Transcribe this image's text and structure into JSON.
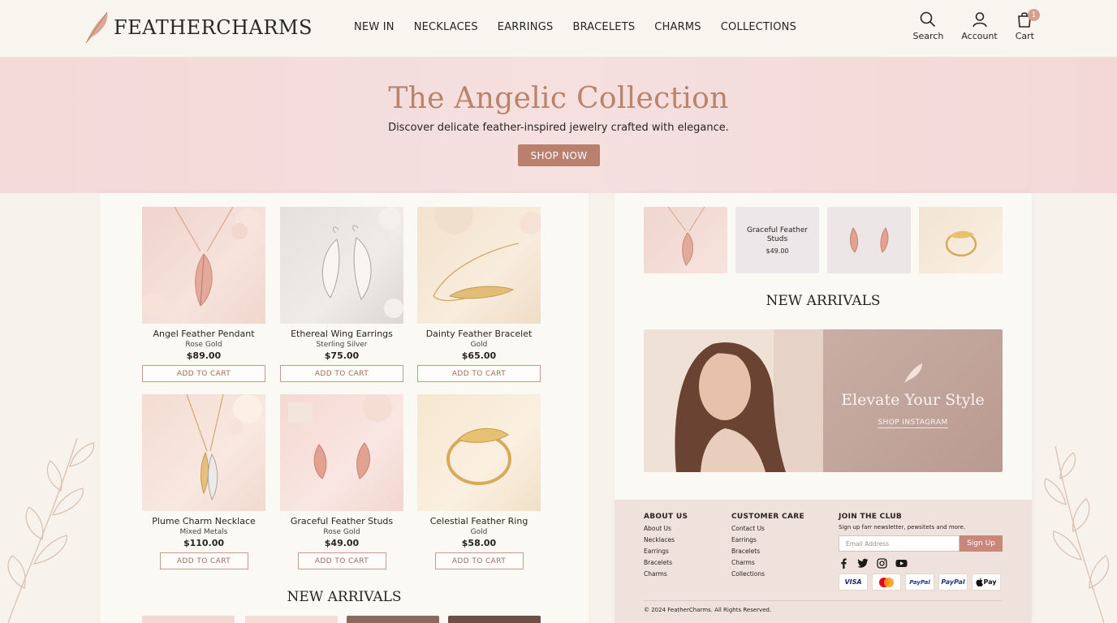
{
  "brand": {
    "name": "FEATHERCHARMS"
  },
  "nav": {
    "items": [
      "NEW IN",
      "NECKLACES",
      "EARRINGS",
      "BRACELETS",
      "CHARMS",
      "COLLECTIONS"
    ]
  },
  "tools": {
    "search": "Search",
    "account": "Account",
    "cart": "Cart",
    "cart_count": "1"
  },
  "hero": {
    "title": "The Angelic Collection",
    "subtitle": "Discover delicate feather-inspired jewelry crafted with elegance.",
    "cta": "SHOP NOW"
  },
  "products": [
    {
      "name": "Angel Feather Pendant",
      "variant": "Rose Gold",
      "price": "$89.00",
      "cta": "ADD TO CART"
    },
    {
      "name": "Ethereal Wing Earrings",
      "variant": "Sterling Silver",
      "price": "$75.00",
      "cta": "ADD TO CART"
    },
    {
      "name": "Dainty Feather Bracelet",
      "variant": "Gold",
      "price": "$65.00",
      "cta": "ADD TO CART"
    },
    {
      "name": "Plume Charm Necklace",
      "variant": "Mixed Metals",
      "price": "$110.00",
      "cta": "ADD TO CART"
    },
    {
      "name": "Graceful Feather Studs",
      "variant": "Rose Gold",
      "price": "$49.00",
      "cta": "ADD TO CART"
    },
    {
      "name": "Celestial Feather Ring",
      "variant": "Gold",
      "price": "$58.00",
      "cta": "ADD TO CART"
    }
  ],
  "new_arrivals": {
    "title": "NEW ARRIVALS"
  },
  "right_thumbs": {
    "name": "Graceful Feather Studs",
    "price": "$49.00"
  },
  "banner": {
    "title": "Elevate Your Style",
    "link": "SHOP INSTAGRAM"
  },
  "footer": {
    "about": {
      "heading": "ABOUT US",
      "links": [
        "About Us",
        "Necklaces",
        "Earrings",
        "Bracelets",
        "Charms"
      ]
    },
    "care": {
      "heading": "CUSTOMER CARE",
      "links": [
        "Contact Us",
        "Earrings",
        "Bracelets",
        "Charms",
        "Collections"
      ]
    },
    "club": {
      "heading": "JOIN THE CLUB",
      "text": "Sign up farr newsletter, pewsitets and more.",
      "placeholder": "Email Address",
      "button": "Sign Up"
    },
    "payments": [
      "VISA",
      "",
      "PayPal",
      "PayPal",
      "Pay"
    ],
    "copyright": "© 2024 FeatherCharms. All Rights Reserved."
  },
  "colors": {
    "accent": "#b9806e",
    "hero_bg": "#f3d9d8",
    "page_bg": "#f7f3ec",
    "footer_bg": "#efe1dc"
  },
  "icons": [
    "feather-icon",
    "search-icon",
    "account-icon",
    "cart-icon",
    "facebook-icon",
    "twitter-icon",
    "instagram-icon",
    "youtube-icon"
  ]
}
